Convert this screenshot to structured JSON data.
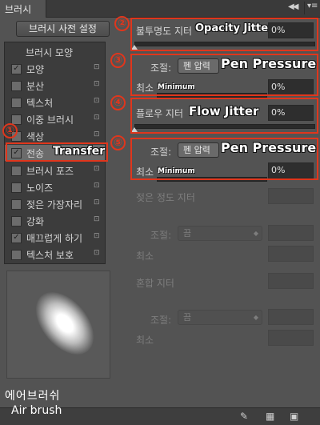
{
  "panel": {
    "tab_title": "브러시",
    "collapse_glyph": "◀◀",
    "menu_glyph": "▾≡"
  },
  "preset_button": "브러시 사전 설정",
  "left_list": {
    "header": "브러시 모양",
    "items": [
      {
        "label": "모양",
        "checked": true,
        "lock": true
      },
      {
        "label": "분산",
        "checked": false,
        "lock": true
      },
      {
        "label": "텍스처",
        "checked": false,
        "lock": true
      },
      {
        "label": "이중 브러시",
        "checked": false,
        "lock": true
      },
      {
        "label": "색상",
        "checked": false,
        "lock": true
      },
      {
        "label": "전송",
        "checked": true,
        "lock": true,
        "selected": true
      },
      {
        "label": "브러시 포즈",
        "checked": false,
        "lock": true
      },
      {
        "label": "노이즈",
        "checked": false,
        "lock": true
      },
      {
        "label": "젖은 가장자리",
        "checked": false,
        "lock": true
      },
      {
        "label": "강화",
        "checked": false,
        "lock": true
      },
      {
        "label": "매끄럽게 하기",
        "checked": true,
        "lock": true
      },
      {
        "label": "텍스처 보호",
        "checked": false,
        "lock": true
      }
    ],
    "check_glyph": "✓",
    "lock_glyph": "🔒",
    "transfer_en": "Transfer"
  },
  "right": {
    "opacity_jitter_label": "불투명도 지터",
    "opacity_jitter_en": "Opacity Jitter",
    "opacity_jitter_value": "0%",
    "control_label": "조절:",
    "pen_pressure": "펜 압력",
    "pen_pressure_en": "Pen Pressure",
    "minimum_label": "최소",
    "minimum_en": "Minimum",
    "minimum_value": "0%",
    "flow_jitter_label": "플로우 지터",
    "flow_jitter_en": "Flow Jitter",
    "flow_jitter_value": "0%",
    "control2_label": "조절:",
    "pen_pressure2": "펜 압력",
    "pen_pressure2_en": "Pen Pressure",
    "minimum2_label": "최소",
    "minimum2_en": "Minimum",
    "minimum2_value": "0%",
    "wetness_jitter_label": "젖은 정도 지터",
    "control3_label": "조절:",
    "off_option": "끔",
    "minimum3_label": "최소",
    "mix_jitter_label": "혼합 지터",
    "control4_label": "조절:",
    "off_option2": "끔",
    "minimum4_label": "최소"
  },
  "annotations": [
    "①",
    "②",
    "③",
    "④",
    "⑤"
  ],
  "caption": {
    "korean": "에어브러쉬",
    "english": "Air brush"
  },
  "colors": {
    "highlight": "#e0361c",
    "panel_bg": "#535353",
    "list_bg": "#3c3c3c"
  },
  "bottom_icons": [
    "brush-toggle-icon",
    "grid-icon",
    "new-preset-icon"
  ]
}
